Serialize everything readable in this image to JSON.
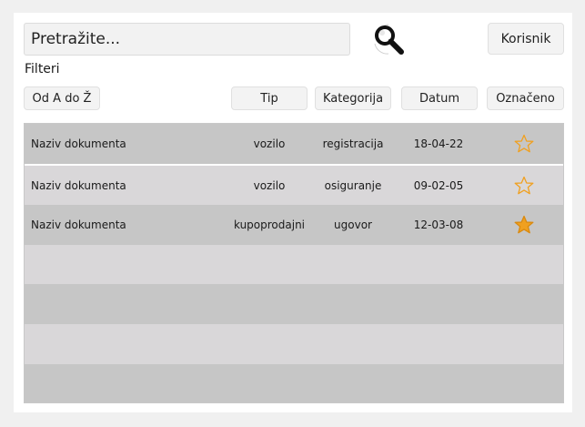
{
  "search": {
    "placeholder": "Pretražite..."
  },
  "header": {
    "user_button": "Korisnik",
    "filters_label": "Filteri"
  },
  "filters": {
    "sort": "Od A do Ž",
    "columns": [
      "Tip",
      "Kategorija",
      "Datum",
      "Označeno"
    ]
  },
  "colors": {
    "row_dark": "#c6c6c6",
    "row_light": "#d9d7d9",
    "star_filled": "#f0a020",
    "star_outline": "#f0a020"
  },
  "documents": [
    {
      "name": "Naziv dokumenta",
      "type": "vozilo",
      "category": "registracija",
      "date": "18-04-22",
      "starred": false
    },
    {
      "name": "Naziv dokumenta",
      "type": "vozilo",
      "category": "osiguranje",
      "date": "09-02-05",
      "starred": false
    },
    {
      "name": "Naziv dokumenta",
      "type": "kupoprodajni",
      "category": "ugovor",
      "date": "12-03-08",
      "starred": true
    }
  ],
  "empty_rows": 4
}
